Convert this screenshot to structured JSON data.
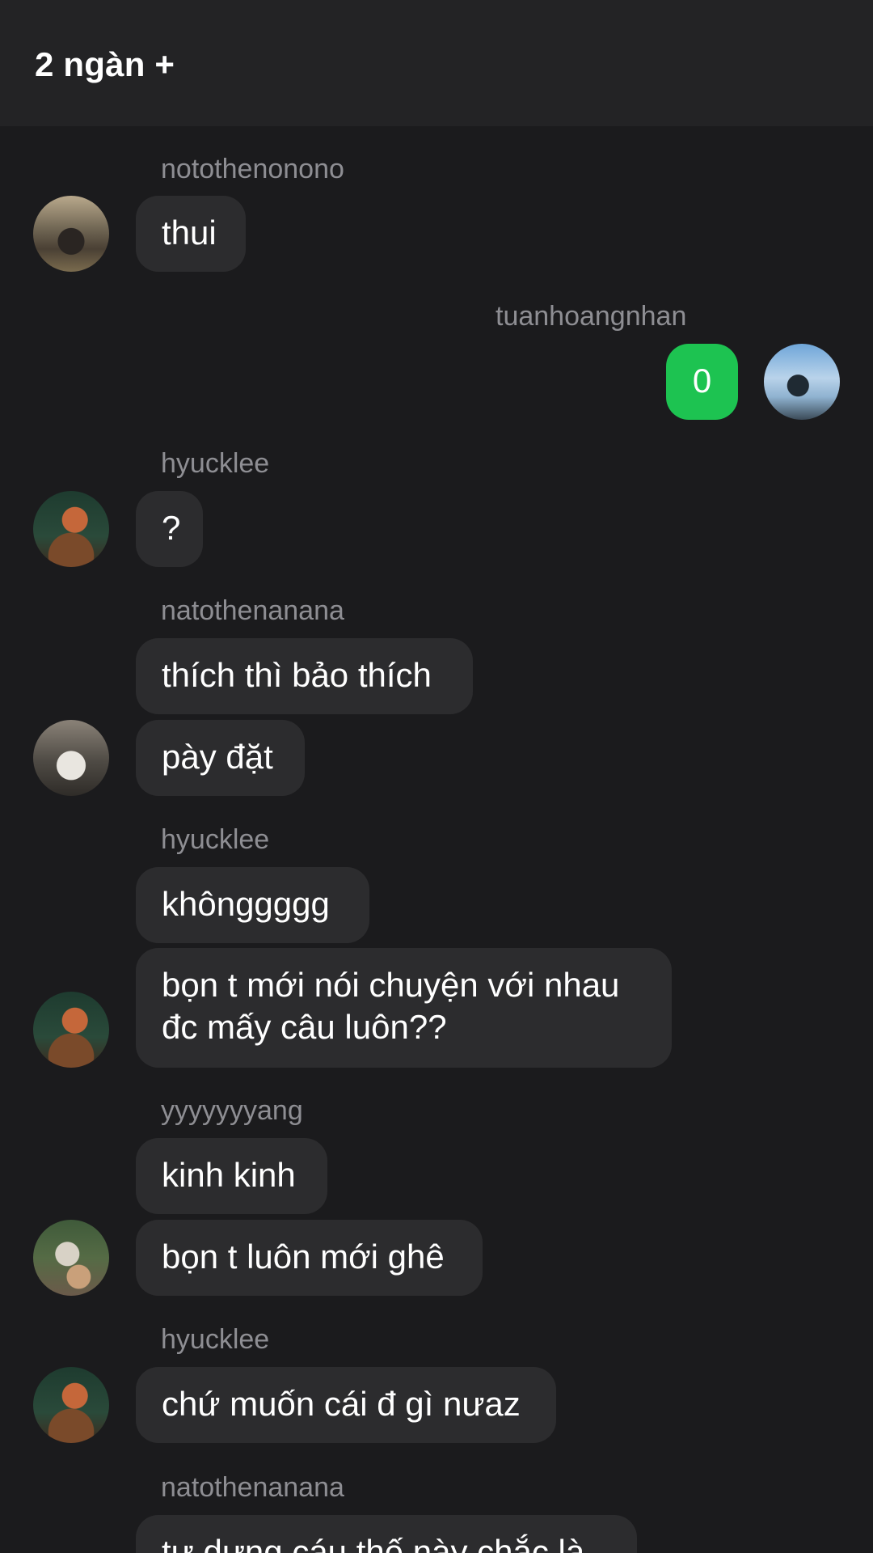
{
  "header": {
    "title": "2 ngàn +"
  },
  "messages": {
    "m1": {
      "sender": "notothenonono",
      "text": "thui"
    },
    "m2": {
      "sender": "tuanhoangnhan",
      "text": "0"
    },
    "m3": {
      "sender": "hyucklee",
      "text": "?"
    },
    "m4": {
      "sender": "natothenanana",
      "text1": "thích thì bảo thích",
      "text2": "pày đặt"
    },
    "m5": {
      "sender": "hyucklee",
      "text1": "khônggggg",
      "text2": "bọn t mới nói chuyện với nhau đc mấy câu luôn??"
    },
    "m6": {
      "sender": "yyyyyyyang",
      "text1": "kinh kinh",
      "text2": "bọn t luôn mới ghê"
    },
    "m7": {
      "sender": "hyucklee",
      "text": "chứ muốn cái đ gì nưaz"
    },
    "m8": {
      "sender": "natothenanana",
      "text": "tự dưng cáu thế này chắc là"
    }
  },
  "colors": {
    "background": "#1b1b1d",
    "header": "#232325",
    "bubble_other": "#2c2c2e",
    "bubble_mine": "#1dc351",
    "sender_text": "#8e8e93"
  }
}
